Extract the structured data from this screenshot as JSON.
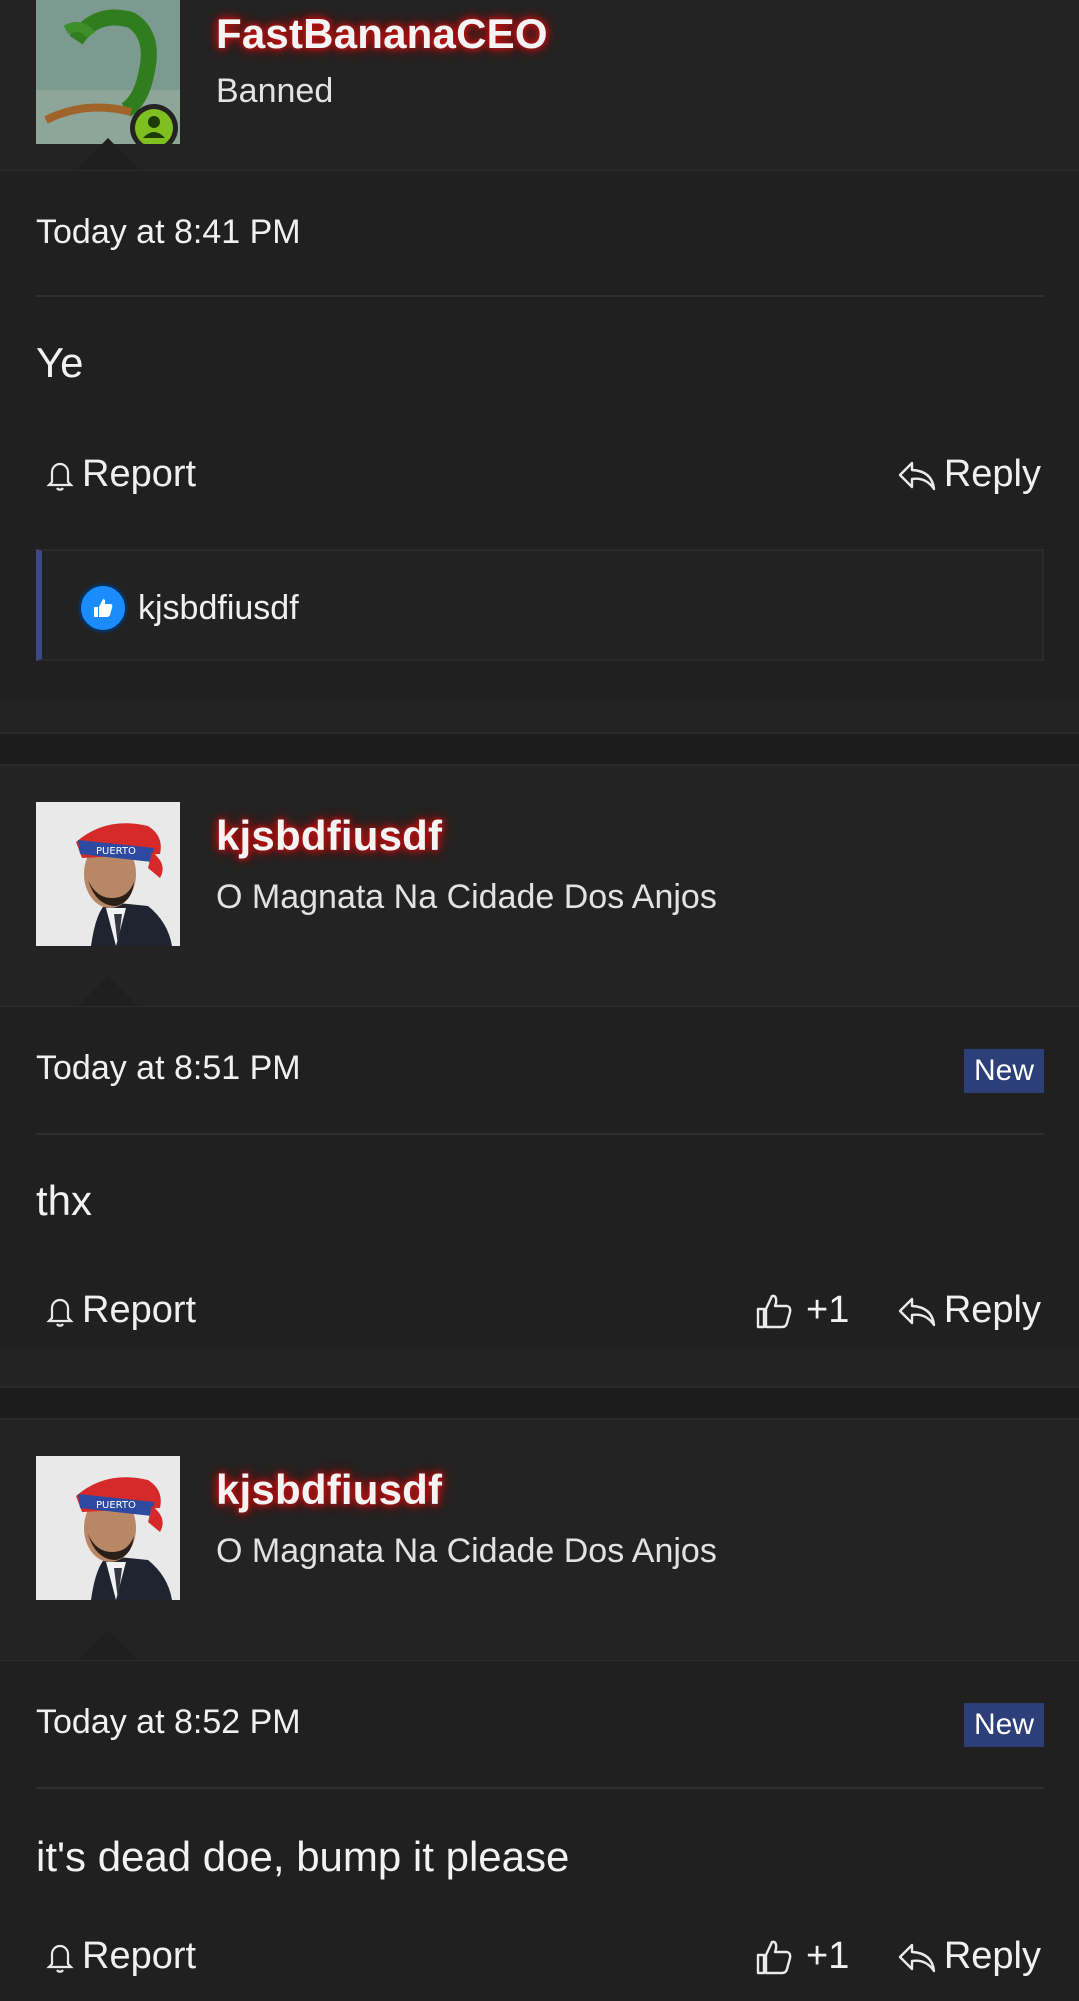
{
  "posts": [
    {
      "username": "FastBananaCEO",
      "usertitle": "Banned",
      "avatar": "avatar-green-figure",
      "time": "Today at 8:41 PM",
      "new_badge": "",
      "message": "Ye",
      "report_label": "Report",
      "reply_label": "Reply",
      "like_count": "",
      "reactions": {
        "icon": "like-icon",
        "users": "kjsbdfiusdf"
      }
    },
    {
      "username": "kjsbdfiusdf",
      "usertitle": "O Magnata Na Cidade Dos Anjos",
      "avatar": "avatar-man-bandana",
      "time": "Today at 8:51 PM",
      "new_badge": "New",
      "message": "thx",
      "report_label": "Report",
      "reply_label": "Reply",
      "like_count": "+1"
    },
    {
      "username": "kjsbdfiusdf",
      "usertitle": "O Magnata Na Cidade Dos Anjos",
      "avatar": "avatar-man-bandana",
      "time": "Today at 8:52 PM",
      "new_badge": "New",
      "message": "it's dead doe, bump it please",
      "report_label": "Report",
      "reply_label": "Reply",
      "like_count": "+1"
    }
  ],
  "colors": {
    "background": "#232323",
    "post_body": "#202020",
    "username_glow": "#c31212",
    "new_badge": "#2d3f78",
    "online_badge": "#7fbf1f",
    "like_blue": "#1a8cff"
  }
}
